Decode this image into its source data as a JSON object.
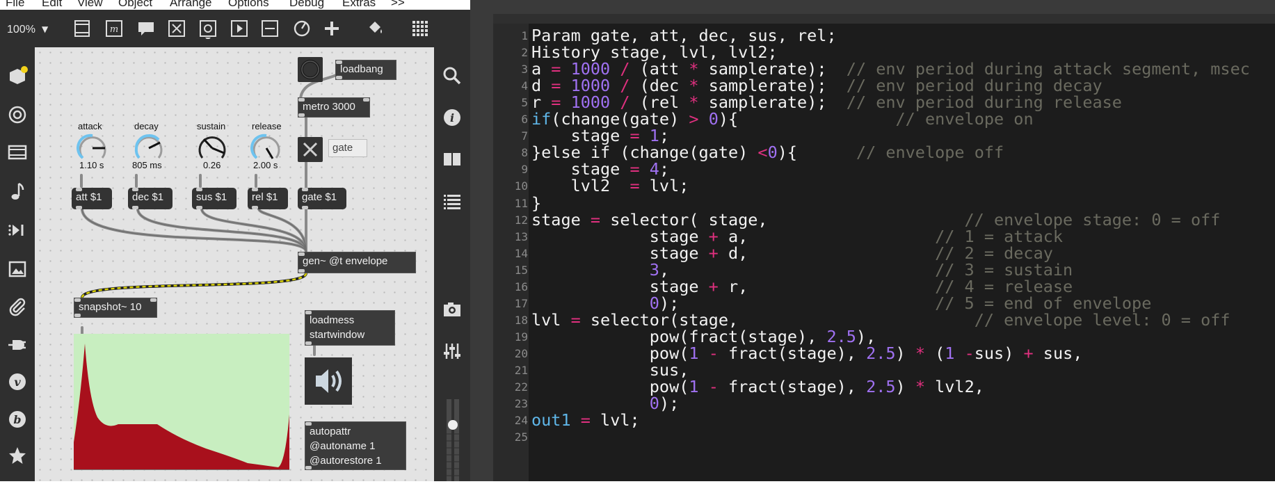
{
  "menu": {
    "items": [
      "File",
      "Edit",
      "View",
      "Object",
      "Arrange",
      "Options",
      "Debug",
      "Extras",
      ">>"
    ]
  },
  "toolbar": {
    "zoom": "100%",
    "icons": [
      "presentation-icon",
      "comment-icon",
      "message-icon",
      "toggle-icon",
      "bang-icon",
      "play-icon",
      "slider-icon",
      "dial-icon",
      "add-icon",
      "paint-bucket-icon",
      "grid-icon"
    ]
  },
  "left_sidebar": {
    "icons": [
      "package-icon",
      "target-icon",
      "film-icon",
      "music-note-icon",
      "step-icon",
      "image-icon",
      "paperclip-icon",
      "plug-icon",
      "vst-v-icon",
      "bpatcher-b-icon",
      "star-icon"
    ],
    "badge_color": "#f2d21b"
  },
  "right_sidebar": {
    "icons": [
      "search-icon",
      "info-icon",
      "book-icon",
      "list-icon",
      "camera-icon",
      "mixer-icon"
    ]
  },
  "patch": {
    "loadbang": "loadbang",
    "metro": "metro 3000",
    "gate_comment": "gate",
    "knobs": [
      {
        "label": "attack",
        "value": "1.10 s"
      },
      {
        "label": "decay",
        "value": "805 ms"
      },
      {
        "label": "sustain",
        "value": "0.26"
      },
      {
        "label": "release",
        "value": "2.00 s"
      }
    ],
    "messages": [
      "att $1",
      "dec $1",
      "sus $1",
      "rel $1",
      "gate $1"
    ],
    "gen": "gen~ @t envelope",
    "snapshot": "snapshot~ 10",
    "loadmess_line1": "loadmess",
    "loadmess_line2": "startwindow",
    "autopattr_line1": "autopattr",
    "autopattr_line2": "@autoname 1",
    "autopattr_line3": "@autorestore 1"
  },
  "colors": {
    "patch_bg": "#e3e3e3",
    "object_bg": "#333333",
    "plot_bg": "#c8eec0",
    "plot_fill": "#a8101c",
    "dial_arc": "#6ec3ef",
    "code_keyword": "#5fb6e8",
    "code_operator": "#e0307f",
    "code_number": "#a071f2",
    "code_comment": "#6a6a5f"
  },
  "code": {
    "lines": [
      [
        [
          "Param gate, att, dec, sus, rel;",
          ""
        ]
      ],
      [
        [
          "History stage, lvl, lvl2;",
          ""
        ]
      ],
      [
        [
          "a ",
          ""
        ],
        [
          "=",
          "op"
        ],
        [
          " ",
          ""
        ],
        [
          "1000",
          "num"
        ],
        [
          " ",
          ""
        ],
        [
          "/",
          "op"
        ],
        [
          " (att ",
          ""
        ],
        [
          "*",
          "op"
        ],
        [
          " samplerate);  ",
          ""
        ],
        [
          "// env period during attack segment, msec",
          "cm"
        ]
      ],
      [
        [
          "d ",
          ""
        ],
        [
          "=",
          "op"
        ],
        [
          " ",
          ""
        ],
        [
          "1000",
          "num"
        ],
        [
          " ",
          ""
        ],
        [
          "/",
          "op"
        ],
        [
          " (dec ",
          ""
        ],
        [
          "*",
          "op"
        ],
        [
          " samplerate);  ",
          ""
        ],
        [
          "// env period during decay",
          "cm"
        ]
      ],
      [
        [
          "r ",
          ""
        ],
        [
          "=",
          "op"
        ],
        [
          " ",
          ""
        ],
        [
          "1000",
          "num"
        ],
        [
          " ",
          ""
        ],
        [
          "/",
          "op"
        ],
        [
          " (rel ",
          ""
        ],
        [
          "*",
          "op"
        ],
        [
          " samplerate);  ",
          ""
        ],
        [
          "// env period during release",
          "cm"
        ]
      ],
      [
        [
          "if",
          "kw"
        ],
        [
          "(change(gate) ",
          ""
        ],
        [
          ">",
          "op"
        ],
        [
          " ",
          ""
        ],
        [
          "0",
          "num"
        ],
        [
          "){                ",
          ""
        ],
        [
          "// envelope on",
          "cm"
        ]
      ],
      [
        [
          "    stage ",
          ""
        ],
        [
          "=",
          "op"
        ],
        [
          " ",
          ""
        ],
        [
          "1",
          "num"
        ],
        [
          ";",
          ""
        ]
      ],
      [
        [
          "}else if (change(gate) ",
          ""
        ],
        [
          "<",
          "op"
        ],
        [
          "0",
          "num"
        ],
        [
          "){      ",
          ""
        ],
        [
          "// envelope off",
          "cm"
        ]
      ],
      [
        [
          "    stage ",
          ""
        ],
        [
          "=",
          "op"
        ],
        [
          " ",
          ""
        ],
        [
          "4",
          "num"
        ],
        [
          ";",
          ""
        ]
      ],
      [
        [
          "    lvl2  ",
          ""
        ],
        [
          "=",
          "op"
        ],
        [
          " lvl;",
          ""
        ]
      ],
      [
        [
          "}",
          ""
        ]
      ],
      [
        [
          "stage ",
          ""
        ],
        [
          "=",
          "op"
        ],
        [
          " selector( stage,                    ",
          ""
        ],
        [
          "// envelope stage: 0 = off",
          "cm"
        ]
      ],
      [
        [
          "            stage ",
          ""
        ],
        [
          "+",
          "op"
        ],
        [
          " a,                   ",
          ""
        ],
        [
          "// 1 = attack",
          "cm"
        ]
      ],
      [
        [
          "            stage ",
          ""
        ],
        [
          "+",
          "op"
        ],
        [
          " d,                   ",
          ""
        ],
        [
          "// 2 = decay",
          "cm"
        ]
      ],
      [
        [
          "            ",
          ""
        ],
        [
          "3",
          "num"
        ],
        [
          ",                           ",
          ""
        ],
        [
          "// 3 = sustain",
          "cm"
        ]
      ],
      [
        [
          "            stage ",
          ""
        ],
        [
          "+",
          "op"
        ],
        [
          " r,                   ",
          ""
        ],
        [
          "// 4 = release",
          "cm"
        ]
      ],
      [
        [
          "            ",
          ""
        ],
        [
          "0",
          "num"
        ],
        [
          ");                          ",
          ""
        ],
        [
          "// 5 = end of envelope",
          "cm"
        ]
      ],
      [
        [
          "lvl ",
          ""
        ],
        [
          "=",
          "op"
        ],
        [
          " selector(stage,                        ",
          ""
        ],
        [
          "// envelope level: 0 = off",
          "cm"
        ]
      ],
      [
        [
          "            pow(fract(stage), ",
          ""
        ],
        [
          "2.5",
          "num"
        ],
        [
          "),",
          ""
        ]
      ],
      [
        [
          "            pow(",
          ""
        ],
        [
          "1",
          "num"
        ],
        [
          " ",
          ""
        ],
        [
          "-",
          "op"
        ],
        [
          " fract(stage), ",
          ""
        ],
        [
          "2.5",
          "num"
        ],
        [
          ") ",
          ""
        ],
        [
          "*",
          "op"
        ],
        [
          " (",
          ""
        ],
        [
          "1",
          "num"
        ],
        [
          " ",
          ""
        ],
        [
          "-",
          "op"
        ],
        [
          "sus) ",
          ""
        ],
        [
          "+",
          "op"
        ],
        [
          " sus,",
          ""
        ]
      ],
      [
        [
          "            sus,",
          ""
        ]
      ],
      [
        [
          "            pow(",
          ""
        ],
        [
          "1",
          "num"
        ],
        [
          " ",
          ""
        ],
        [
          "-",
          "op"
        ],
        [
          " fract(stage), ",
          ""
        ],
        [
          "2.5",
          "num"
        ],
        [
          ") ",
          ""
        ],
        [
          "*",
          "op"
        ],
        [
          " lvl2,",
          ""
        ]
      ],
      [
        [
          "            ",
          ""
        ],
        [
          "0",
          "num"
        ],
        [
          ");",
          ""
        ]
      ],
      [
        [
          "out1",
          "kw"
        ],
        [
          " ",
          ""
        ],
        [
          "=",
          "op"
        ],
        [
          " lvl;",
          ""
        ]
      ],
      [
        [
          "",
          ""
        ]
      ]
    ]
  }
}
